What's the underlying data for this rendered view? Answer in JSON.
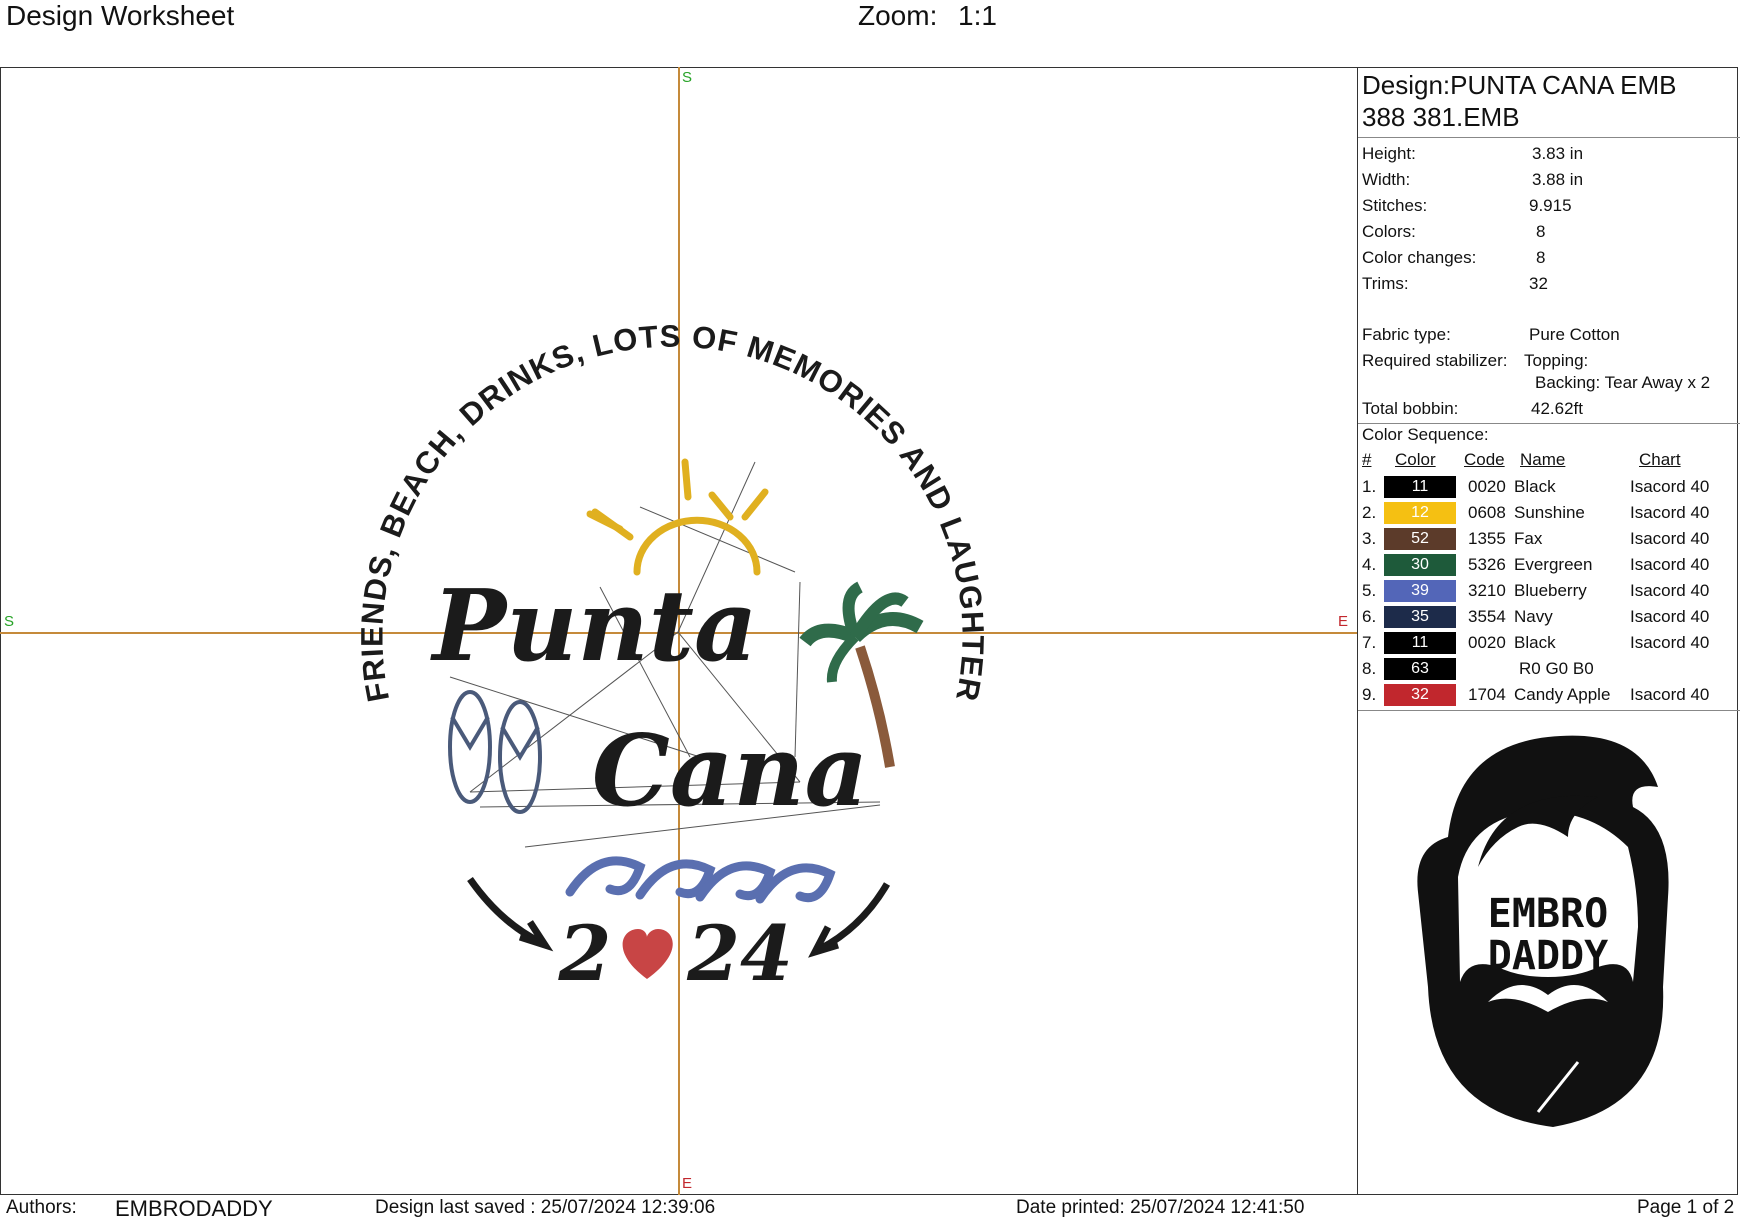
{
  "header": {
    "title": "Design Worksheet",
    "zoom_label": "Zoom:",
    "zoom_value": "1:1"
  },
  "canvas": {
    "markers": {
      "top": "S",
      "left": "S",
      "right": "E",
      "bottom": "E"
    },
    "design": {
      "arc_text": "FRIENDS, BEACH, DRINKS, LOTS OF MEMORIES AND LAUGHTER",
      "line1": "Punta",
      "line2": "Cana",
      "year_left": "2",
      "year_right": "24"
    }
  },
  "info_panel": {
    "design_name_line1": "Design:PUNTA CANA EMB",
    "design_name_line2": "388 381.EMB",
    "fields": [
      {
        "label": "Height:",
        "value": "3.83 in"
      },
      {
        "label": "Width:",
        "value": "3.88 in"
      },
      {
        "label": "Stitches:",
        "value": "9.915"
      },
      {
        "label": "Colors:",
        "value": "8"
      },
      {
        "label": "Color changes:",
        "value": "8"
      },
      {
        "label": "Trims:",
        "value": "32"
      }
    ],
    "fabric_label": "Fabric type:",
    "fabric_value": "Pure Cotton",
    "stabilizer_label": "Required stabilizer:",
    "stabilizer_topping": "Topping:",
    "stabilizer_backing": "Backing: Tear Away x 2",
    "bobbin_label": "Total bobbin:",
    "bobbin_value": "42.62ft",
    "color_sequence_title": "Color Sequence:",
    "columns": {
      "num": "#",
      "color": "Color",
      "code": "Code",
      "name": "Name",
      "chart": "Chart"
    },
    "color_sequence": [
      {
        "num": "1.",
        "swatch": "11",
        "hex": "#000000",
        "code": "0020",
        "name": "Black",
        "chart": "Isacord 40"
      },
      {
        "num": "2.",
        "swatch": "12",
        "hex": "#f5c012",
        "code": "0608",
        "name": "Sunshine",
        "chart": "Isacord 40"
      },
      {
        "num": "3.",
        "swatch": "52",
        "hex": "#5c3b2a",
        "code": "1355",
        "name": "Fax",
        "chart": "Isacord 40"
      },
      {
        "num": "4.",
        "swatch": "30",
        "hex": "#1e5a3a",
        "code": "5326",
        "name": "Evergreen",
        "chart": "Isacord 40"
      },
      {
        "num": "5.",
        "swatch": "39",
        "hex": "#5366b8",
        "code": "3210",
        "name": "Blueberry",
        "chart": "Isacord 40"
      },
      {
        "num": "6.",
        "swatch": "35",
        "hex": "#1d2b4a",
        "code": "3554",
        "name": "Navy",
        "chart": "Isacord 40"
      },
      {
        "num": "7.",
        "swatch": "11",
        "hex": "#000000",
        "code": "0020",
        "name": "Black",
        "chart": "Isacord 40"
      },
      {
        "num": "8.",
        "swatch": "63",
        "hex": "#000000",
        "code": "",
        "name": "R0 G0 B0",
        "chart": ""
      },
      {
        "num": "9.",
        "swatch": "32",
        "hex": "#c1272d",
        "code": "1704",
        "name": "Candy Apple",
        "chart": "Isacord 40"
      }
    ],
    "logo_line1": "EMBRO",
    "logo_line2": "DADDY"
  },
  "footer": {
    "authors_label": "Authors:",
    "authors_value": "EMBRODADDY",
    "saved": "Design last saved : 25/07/2024 12:39:06",
    "printed": "Date printed: 25/07/2024 12:41:50",
    "page": "Page 1 of 2"
  }
}
